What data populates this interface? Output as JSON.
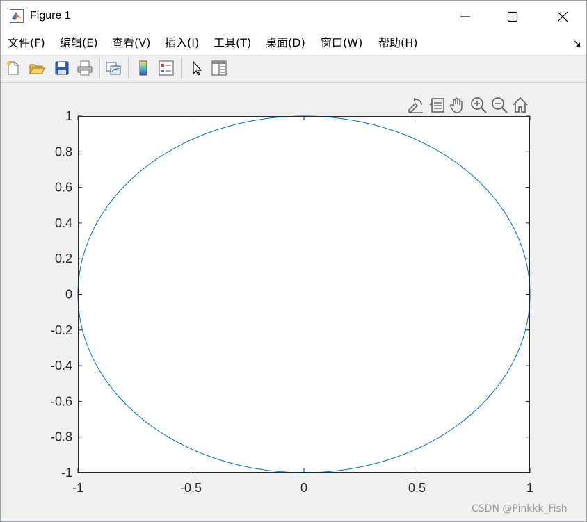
{
  "window": {
    "title": "Figure 1",
    "controls": [
      "minimize",
      "maximize",
      "close"
    ]
  },
  "menu": {
    "items": [
      "文件(F)",
      "编辑(E)",
      "查看(V)",
      "插入(I)",
      "工具(T)",
      "桌面(D)",
      "窗口(W)",
      "帮助(H)"
    ]
  },
  "toolbar": {
    "buttons": [
      "new-figure-icon",
      "open-file-icon",
      "save-icon",
      "print-icon",
      "link-plot-icon",
      "colorbar-icon",
      "legend-icon",
      "edit-plot-arrow-icon",
      "property-inspector-icon"
    ]
  },
  "axes_toolbar": {
    "buttons": [
      "export-icon",
      "data-tips-icon",
      "pan-icon",
      "zoom-in-icon",
      "zoom-out-icon",
      "home-icon"
    ]
  },
  "colors": {
    "line": "#0072BD",
    "figure_bg": "#F0F0F0",
    "axes_bg": "#FFFFFF"
  },
  "chart_data": {
    "type": "line",
    "title": "",
    "xlabel": "",
    "ylabel": "",
    "xlim": [
      -1,
      1
    ],
    "ylim": [
      -1,
      1
    ],
    "xticks": [
      -1,
      -0.5,
      0,
      0.5,
      1
    ],
    "xtick_labels": [
      "-1",
      "-0.5",
      "0",
      "0.5",
      "1"
    ],
    "yticks": [
      -1,
      -0.8,
      -0.6,
      -0.4,
      -0.2,
      0,
      0.2,
      0.4,
      0.6,
      0.8,
      1
    ],
    "ytick_labels": [
      "-1",
      "-0.8",
      "-0.6",
      "-0.4",
      "-0.2",
      "0",
      "0.2",
      "0.4",
      "0.6",
      "0.8",
      "1"
    ],
    "grid": false,
    "series": [
      {
        "curve": "unit circle",
        "x": [
          1,
          0.951,
          0.809,
          0.588,
          0.309,
          0,
          -0.309,
          -0.588,
          -0.809,
          -0.951,
          -1,
          -0.951,
          -0.809,
          -0.588,
          -0.309,
          0,
          0.309,
          0.588,
          0.809,
          0.951,
          1
        ],
        "y": [
          0,
          0.309,
          0.588,
          0.809,
          0.951,
          1,
          0.951,
          0.809,
          0.588,
          0.309,
          0,
          -0.309,
          -0.588,
          -0.809,
          -0.951,
          -1,
          -0.951,
          -0.809,
          -0.588,
          -0.309,
          0
        ]
      }
    ]
  },
  "watermark": "CSDN @Pinkkk_Fish"
}
